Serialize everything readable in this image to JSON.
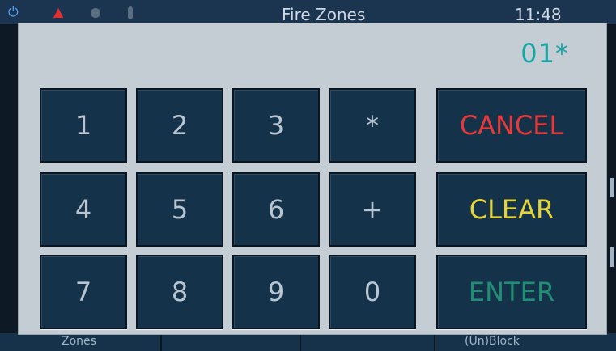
{
  "header": {
    "title": "Fire Zones",
    "time": "11:48"
  },
  "footer": {
    "tab_left": "Zones",
    "tab_right": "(Un)Block"
  },
  "keypad": {
    "entry_value": "01*",
    "keys": [
      "1",
      "2",
      "3",
      "*",
      "4",
      "5",
      "6",
      "+",
      "7",
      "8",
      "9",
      "0"
    ],
    "cancel_label": "CANCEL",
    "clear_label": "CLEAR",
    "enter_label": "ENTER"
  },
  "colors": {
    "cancel": "#e8393a",
    "clear": "#e3d43a",
    "enter": "#1f8f73",
    "entry": "#1aa5a5"
  }
}
